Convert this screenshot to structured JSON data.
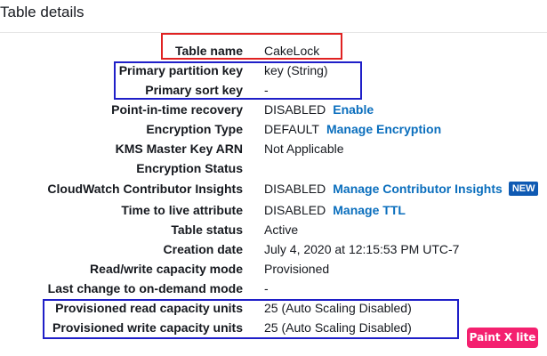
{
  "section": {
    "title": "Table details"
  },
  "rows": [
    {
      "label": "Table name",
      "value": "CakeLock"
    },
    {
      "label": "Primary partition key",
      "value": "key (String)"
    },
    {
      "label": "Primary sort key",
      "value": "-"
    },
    {
      "label": "Point-in-time recovery",
      "value": "DISABLED",
      "link": "Enable"
    },
    {
      "label": "Encryption Type",
      "value": "DEFAULT",
      "link": "Manage Encryption"
    },
    {
      "label": "KMS Master Key ARN",
      "value": "Not Applicable"
    },
    {
      "label": "Encryption Status",
      "value": ""
    },
    {
      "label": "CloudWatch Contributor Insights",
      "value": "DISABLED",
      "link": "Manage Contributor Insights",
      "badge": "NEW"
    },
    {
      "label": "Time to live attribute",
      "value": "DISABLED",
      "link": "Manage TTL"
    },
    {
      "label": "Table status",
      "value": "Active"
    },
    {
      "label": "Creation date",
      "value": "July 4, 2020 at 12:15:53 PM UTC-7"
    },
    {
      "label": "Read/write capacity mode",
      "value": "Provisioned"
    },
    {
      "label": "Last change to on-demand mode",
      "value": "-"
    },
    {
      "label": "Provisioned read capacity units",
      "value": "25 (Auto Scaling Disabled)"
    },
    {
      "label": "Provisioned write capacity units",
      "value": "25 (Auto Scaling Disabled)"
    }
  ],
  "watermark": {
    "text": "Paint X lite"
  },
  "colors": {
    "link": "#0a6ebd",
    "badge": "#0f5ab3",
    "annotation_red": "#e02222",
    "annotation_blue": "#1f1fc8",
    "watermark": "#f4206f"
  }
}
